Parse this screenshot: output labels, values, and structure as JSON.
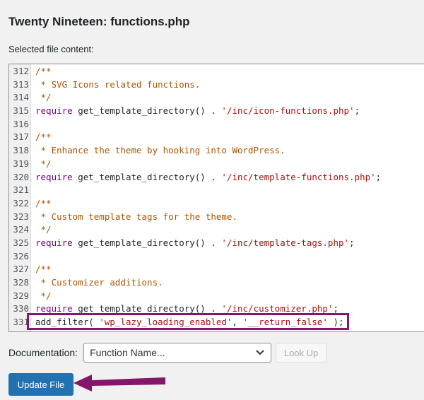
{
  "header": {
    "title": "Twenty Nineteen: functions.php",
    "content_label": "Selected file content:"
  },
  "editor": {
    "lines": [
      {
        "num": "312",
        "tokens": [
          {
            "t": "comment",
            "v": "/**"
          }
        ]
      },
      {
        "num": "313",
        "tokens": [
          {
            "t": "comment",
            "v": " * SVG Icons related functions."
          }
        ]
      },
      {
        "num": "314",
        "tokens": [
          {
            "t": "comment",
            "v": " */"
          }
        ]
      },
      {
        "num": "315",
        "tokens": [
          {
            "t": "keyword",
            "v": "require"
          },
          {
            "t": "plain",
            "v": " get_template_directory() . "
          },
          {
            "t": "string",
            "v": "'/inc/icon-functions.php'"
          },
          {
            "t": "plain",
            "v": ";"
          }
        ]
      },
      {
        "num": "316",
        "tokens": []
      },
      {
        "num": "317",
        "tokens": [
          {
            "t": "comment",
            "v": "/**"
          }
        ]
      },
      {
        "num": "318",
        "tokens": [
          {
            "t": "comment",
            "v": " * Enhance the theme by hooking into WordPress."
          }
        ]
      },
      {
        "num": "319",
        "tokens": [
          {
            "t": "comment",
            "v": " */"
          }
        ]
      },
      {
        "num": "320",
        "tokens": [
          {
            "t": "keyword",
            "v": "require"
          },
          {
            "t": "plain",
            "v": " get_template_directory() . "
          },
          {
            "t": "string",
            "v": "'/inc/template-functions.php'"
          },
          {
            "t": "plain",
            "v": ";"
          }
        ]
      },
      {
        "num": "321",
        "tokens": []
      },
      {
        "num": "322",
        "tokens": [
          {
            "t": "comment",
            "v": "/**"
          }
        ]
      },
      {
        "num": "323",
        "tokens": [
          {
            "t": "comment",
            "v": " * Custom template tags for the theme."
          }
        ]
      },
      {
        "num": "324",
        "tokens": [
          {
            "t": "comment",
            "v": " */"
          }
        ]
      },
      {
        "num": "325",
        "tokens": [
          {
            "t": "keyword",
            "v": "require"
          },
          {
            "t": "plain",
            "v": " get_template_directory() . "
          },
          {
            "t": "string",
            "v": "'/inc/template-tags.php'"
          },
          {
            "t": "plain",
            "v": ";"
          }
        ]
      },
      {
        "num": "326",
        "tokens": []
      },
      {
        "num": "327",
        "tokens": [
          {
            "t": "comment",
            "v": "/**"
          }
        ]
      },
      {
        "num": "328",
        "tokens": [
          {
            "t": "comment",
            "v": " * Customizer additions."
          }
        ]
      },
      {
        "num": "329",
        "tokens": [
          {
            "t": "comment",
            "v": " */"
          }
        ]
      },
      {
        "num": "330",
        "tokens": [
          {
            "t": "keyword",
            "v": "require"
          },
          {
            "t": "plain",
            "v": " get_template_directory() . "
          },
          {
            "t": "string",
            "v": "'/inc/customizer.php'"
          },
          {
            "t": "plain",
            "v": ";"
          }
        ]
      },
      {
        "num": "331",
        "tokens": [
          {
            "t": "plain",
            "v": "add_filter( "
          },
          {
            "t": "string",
            "v": "'wp_lazy_loading_enabled'"
          },
          {
            "t": "plain",
            "v": ", "
          },
          {
            "t": "string",
            "v": "'__return_false'"
          },
          {
            "t": "plain",
            "v": " );"
          }
        ]
      }
    ]
  },
  "documentation": {
    "label": "Documentation:",
    "select_value": "Function Name...",
    "lookup_label": "Look Up"
  },
  "actions": {
    "update_label": "Update File"
  },
  "colors": {
    "annotation": "#86166b",
    "primary": "#2271b1"
  },
  "icons": {
    "dropdown": "chevron-down-icon",
    "pointer": "arrow-left-icon"
  }
}
